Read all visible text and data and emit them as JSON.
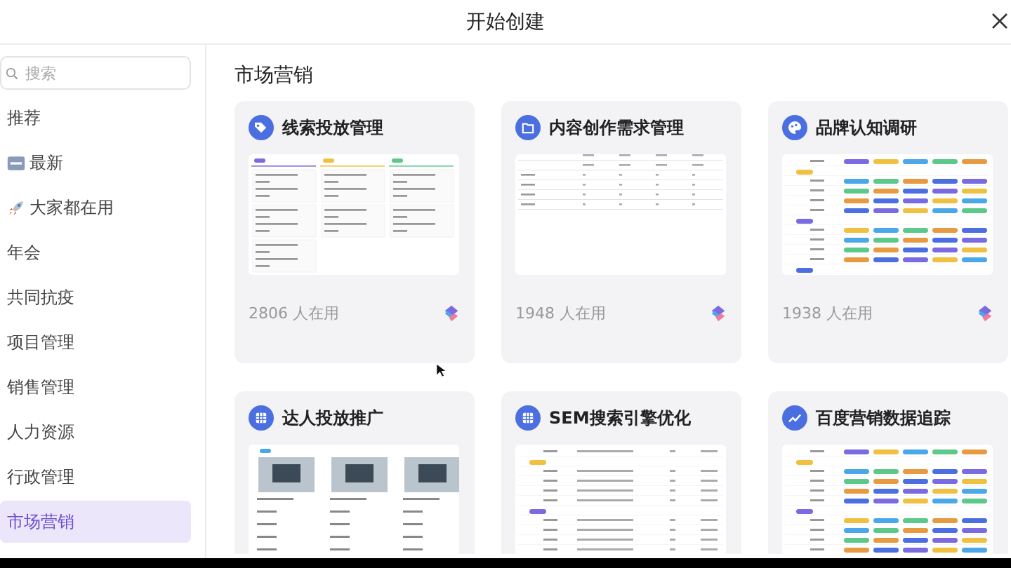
{
  "window": {
    "title": "开始创建"
  },
  "search": {
    "placeholder": "搜索"
  },
  "sidebar": {
    "items": [
      {
        "label": "推荐",
        "selected": false
      },
      {
        "label": "最新",
        "selected": false
      },
      {
        "label": "大家都在用",
        "selected": false
      },
      {
        "label": "年会",
        "selected": false
      },
      {
        "label": "共同抗疫",
        "selected": false
      },
      {
        "label": "项目管理",
        "selected": false
      },
      {
        "label": "销售管理",
        "selected": false
      },
      {
        "label": "人力资源",
        "selected": false
      },
      {
        "label": "行政管理",
        "selected": false
      },
      {
        "label": "市场营销",
        "selected": true
      }
    ]
  },
  "section": {
    "title": "市场营销"
  },
  "cards": [
    {
      "title": "线索投放管理",
      "users": "2806 人在用"
    },
    {
      "title": "内容创作需求管理",
      "users": "1948 人在用"
    },
    {
      "title": "品牌认知调研",
      "users": "1938 人在用"
    },
    {
      "title": "达人投放推广"
    },
    {
      "title": "SEM搜索引擎优化"
    },
    {
      "title": "百度营销数据追踪"
    }
  ]
}
